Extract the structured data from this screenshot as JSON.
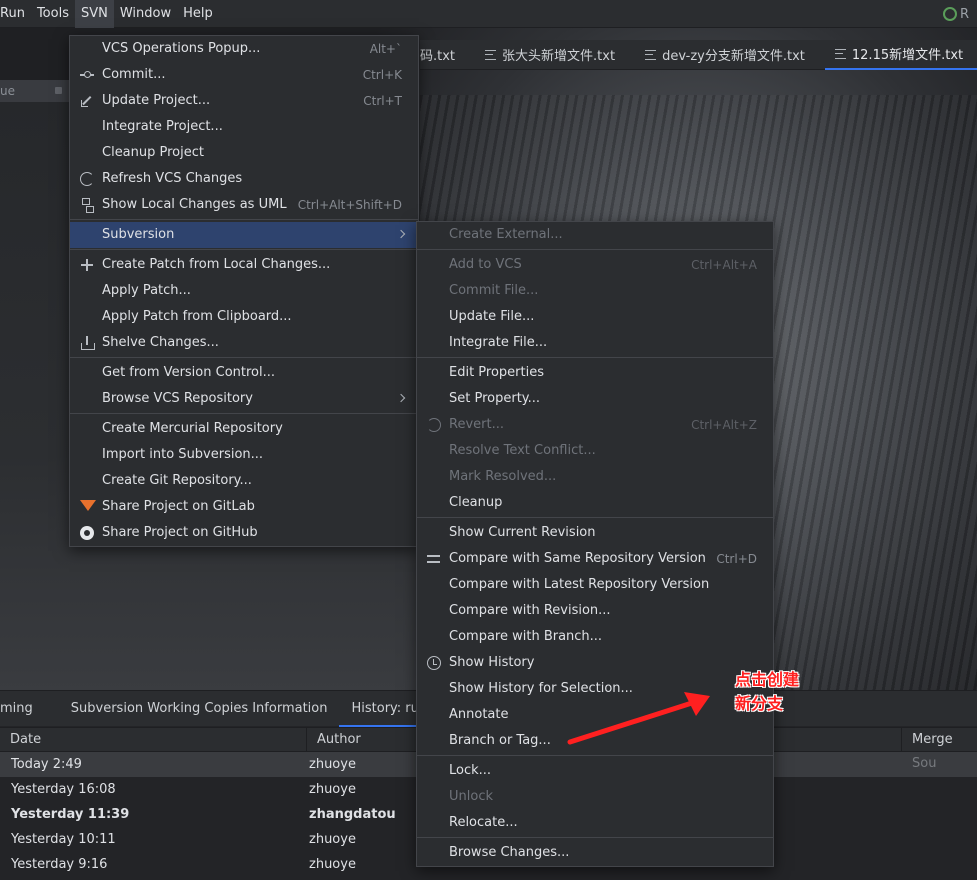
{
  "menubar": {
    "items": [
      "Run",
      "Tools",
      "SVN",
      "Window",
      "Help"
    ],
    "active_index": 2,
    "right_label": "R"
  },
  "editor_tabs": [
    {
      "label": "码.txt",
      "active": false
    },
    {
      "label": "张大头新增文件.txt",
      "active": false
    },
    {
      "label": "dev-zy分支新增文件.txt",
      "active": false
    },
    {
      "label": "12.15新增文件.txt",
      "active": true
    }
  ],
  "project_strip": {
    "label": "ue"
  },
  "svn_menu": {
    "groups": [
      [
        {
          "label": "VCS Operations Popup...",
          "shortcut": "Alt+`",
          "icon": ""
        },
        {
          "label": "Commit...",
          "shortcut": "Ctrl+K",
          "icon": "commit-icon"
        },
        {
          "label": "Update Project...",
          "shortcut": "Ctrl+T",
          "icon": "update-icon"
        },
        {
          "label": "Integrate Project...",
          "shortcut": "",
          "icon": ""
        },
        {
          "label": "Cleanup Project",
          "shortcut": "",
          "icon": ""
        },
        {
          "label": "Refresh VCS Changes",
          "shortcut": "",
          "icon": "refresh-icon"
        },
        {
          "label": "Show Local Changes as UML",
          "shortcut": "Ctrl+Alt+Shift+D",
          "icon": "uml-icon"
        }
      ],
      [
        {
          "label": "Subversion",
          "shortcut": "",
          "icon": "",
          "submenu": true,
          "highlighted": true
        }
      ],
      [
        {
          "label": "Create Patch from Local Changes...",
          "shortcut": "",
          "icon": "plus-icon"
        },
        {
          "label": "Apply Patch...",
          "shortcut": "",
          "icon": ""
        },
        {
          "label": "Apply Patch from Clipboard...",
          "shortcut": "",
          "icon": ""
        },
        {
          "label": "Shelve Changes...",
          "shortcut": "",
          "icon": "shelve-icon"
        }
      ],
      [
        {
          "label": "Get from Version Control...",
          "shortcut": "",
          "icon": ""
        },
        {
          "label": "Browse VCS Repository",
          "shortcut": "",
          "icon": "",
          "submenu": true
        }
      ],
      [
        {
          "label": "Create Mercurial Repository",
          "shortcut": "",
          "icon": ""
        },
        {
          "label": "Import into Subversion...",
          "shortcut": "",
          "icon": ""
        },
        {
          "label": "Create Git Repository...",
          "shortcut": "",
          "icon": ""
        },
        {
          "label": "Share Project on GitLab",
          "shortcut": "",
          "icon": "gitlab-icon"
        },
        {
          "label": "Share Project on GitHub",
          "shortcut": "",
          "icon": "github-icon"
        }
      ]
    ]
  },
  "subversion_menu": {
    "groups": [
      [
        {
          "label": "Create External...",
          "shortcut": "",
          "disabled": true,
          "icon": ""
        }
      ],
      [
        {
          "label": "Add to VCS",
          "shortcut": "Ctrl+Alt+A",
          "disabled": true,
          "icon": ""
        },
        {
          "label": "Commit File...",
          "shortcut": "",
          "disabled": true,
          "icon": ""
        },
        {
          "label": "Update File...",
          "shortcut": "",
          "disabled": false,
          "icon": ""
        },
        {
          "label": "Integrate File...",
          "shortcut": "",
          "disabled": false,
          "icon": ""
        }
      ],
      [
        {
          "label": "Edit Properties",
          "shortcut": "",
          "disabled": false,
          "icon": ""
        },
        {
          "label": "Set Property...",
          "shortcut": "",
          "disabled": false,
          "icon": ""
        },
        {
          "label": "Revert...",
          "shortcut": "Ctrl+Alt+Z",
          "disabled": true,
          "icon": "revert-icon"
        },
        {
          "label": "Resolve Text Conflict...",
          "shortcut": "",
          "disabled": true,
          "icon": ""
        },
        {
          "label": "Mark Resolved...",
          "shortcut": "",
          "disabled": true,
          "icon": ""
        },
        {
          "label": "Cleanup",
          "shortcut": "",
          "disabled": false,
          "icon": ""
        }
      ],
      [
        {
          "label": "Show Current Revision",
          "shortcut": "",
          "disabled": false,
          "icon": ""
        },
        {
          "label": "Compare with Same Repository Version",
          "shortcut": "Ctrl+D",
          "disabled": false,
          "icon": "compare-icon"
        },
        {
          "label": "Compare with Latest Repository Version",
          "shortcut": "",
          "disabled": false,
          "icon": ""
        },
        {
          "label": "Compare with Revision...",
          "shortcut": "",
          "disabled": false,
          "icon": ""
        },
        {
          "label": "Compare with Branch...",
          "shortcut": "",
          "disabled": false,
          "icon": ""
        },
        {
          "label": "Show History",
          "shortcut": "",
          "disabled": false,
          "icon": "clock-icon"
        },
        {
          "label": "Show History for Selection...",
          "shortcut": "",
          "disabled": false,
          "icon": ""
        },
        {
          "label": "Annotate",
          "shortcut": "",
          "disabled": false,
          "icon": ""
        },
        {
          "label": "Branch or Tag...",
          "shortcut": "",
          "disabled": false,
          "icon": ""
        }
      ],
      [
        {
          "label": "Lock...",
          "shortcut": "",
          "disabled": false,
          "icon": ""
        },
        {
          "label": "Unlock",
          "shortcut": "",
          "disabled": true,
          "icon": ""
        },
        {
          "label": "Relocate...",
          "shortcut": "",
          "disabled": false,
          "icon": ""
        }
      ],
      [
        {
          "label": "Browse Changes...",
          "shortcut": "",
          "disabled": false,
          "icon": ""
        }
      ]
    ]
  },
  "bottom_tabs": [
    {
      "label": "ming",
      "active": false
    },
    {
      "label": "Subversion Working Copies Information",
      "active": false
    },
    {
      "label": "History: ruoyi-vue",
      "active": true
    }
  ],
  "history_table": {
    "columns": [
      "Date",
      "Author",
      "Merge Sou"
    ],
    "rows": [
      {
        "date": "Today 2:49",
        "author": "zhuoye",
        "bold": false,
        "selected": true
      },
      {
        "date": "Yesterday 16:08",
        "author": "zhuoye",
        "bold": false,
        "selected": false
      },
      {
        "date": "Yesterday 11:39",
        "author": "zhangdatou",
        "bold": true,
        "selected": false
      },
      {
        "date": "Yesterday 10:11",
        "author": "zhuoye",
        "bold": false,
        "selected": false
      },
      {
        "date": "Yesterday 9:16",
        "author": "zhuoye",
        "bold": false,
        "selected": false
      }
    ]
  },
  "annotation": {
    "line1": "点击创建",
    "line2": "新分支",
    "color": "#ff2020"
  }
}
